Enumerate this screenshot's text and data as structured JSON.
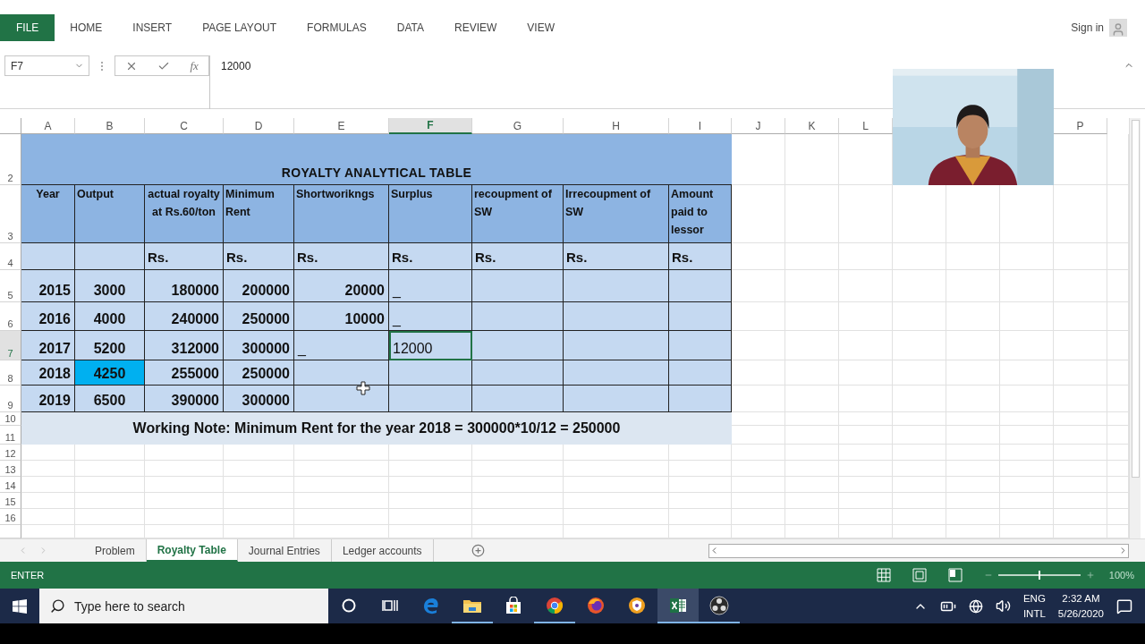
{
  "ribbon": {
    "tabs": [
      {
        "label": "FILE",
        "kind": "file"
      },
      {
        "label": "HOME",
        "kind": "tab"
      },
      {
        "label": "INSERT",
        "kind": "tab"
      },
      {
        "label": "PAGE LAYOUT",
        "kind": "tab"
      },
      {
        "label": "FORMULAS",
        "kind": "tab"
      },
      {
        "label": "DATA",
        "kind": "tab"
      },
      {
        "label": "REVIEW",
        "kind": "tab"
      },
      {
        "label": "VIEW",
        "kind": "tab"
      }
    ],
    "sign_in": "Sign in"
  },
  "formula_bar": {
    "name_box": "F7",
    "fx": "fx",
    "value": "12000"
  },
  "sheet": {
    "columns": [
      {
        "label": "A",
        "selected": false
      },
      {
        "label": "B",
        "selected": false
      },
      {
        "label": "C",
        "selected": false
      },
      {
        "label": "D",
        "selected": false
      },
      {
        "label": "E",
        "selected": false
      },
      {
        "label": "F",
        "selected": true
      },
      {
        "label": "G",
        "selected": false
      },
      {
        "label": "H",
        "selected": false
      },
      {
        "label": "I",
        "selected": false
      },
      {
        "label": "J",
        "selected": false
      },
      {
        "label": "K",
        "selected": false
      },
      {
        "label": "L",
        "selected": false
      },
      {
        "label": "P",
        "selected": false
      }
    ],
    "row_numbers": [
      {
        "label": "2",
        "selected": false
      },
      {
        "label": "3",
        "selected": false
      },
      {
        "label": "4",
        "selected": false
      },
      {
        "label": "5",
        "selected": false
      },
      {
        "label": "6",
        "selected": false
      },
      {
        "label": "7",
        "selected": true
      },
      {
        "label": "8",
        "selected": false
      },
      {
        "label": "9",
        "selected": false
      },
      {
        "label": "10",
        "selected": false
      },
      {
        "label": "11",
        "selected": false
      },
      {
        "label": "12",
        "selected": false
      },
      {
        "label": "13",
        "selected": false
      },
      {
        "label": "14",
        "selected": false
      },
      {
        "label": "15",
        "selected": false
      },
      {
        "label": "16",
        "selected": false
      }
    ],
    "title": "ROYALTY ANALYTICAL TABLE",
    "headers": [
      "Year",
      "Output",
      "actual royalty at Rs.60/ton",
      "Minimum Rent",
      "Shortworikngs",
      "Surplus",
      "recoupment of SW",
      "Irrecoupment of SW",
      "Amount paid to lessor"
    ],
    "units": [
      "Rs.",
      "Rs.",
      "Rs.",
      "Rs.",
      "Rs.",
      "Rs.",
      "Rs."
    ],
    "rows": [
      {
        "cells": [
          {
            "text": "2015",
            "kind": "number",
            "selected": false,
            "highlighted": false
          },
          {
            "text": "3000",
            "kind": "number",
            "selected": false,
            "highlighted": false
          },
          {
            "text": "180000",
            "kind": "number",
            "selected": false,
            "highlighted": false
          },
          {
            "text": "200000",
            "kind": "number",
            "selected": false,
            "highlighted": false
          },
          {
            "text": "20000",
            "kind": "number",
            "selected": false,
            "highlighted": false
          },
          {
            "text": "_",
            "kind": "text",
            "selected": false,
            "highlighted": false
          },
          {
            "selected": false,
            "highlighted": false
          },
          {
            "selected": false,
            "highlighted": false
          },
          {
            "selected": false,
            "highlighted": false
          }
        ]
      },
      {
        "cells": [
          {
            "text": "2016",
            "kind": "number",
            "selected": false,
            "highlighted": false
          },
          {
            "text": "4000",
            "kind": "number",
            "selected": false,
            "highlighted": false
          },
          {
            "text": "240000",
            "kind": "number",
            "selected": false,
            "highlighted": false
          },
          {
            "text": "250000",
            "kind": "number",
            "selected": false,
            "highlighted": false
          },
          {
            "text": "10000",
            "kind": "number",
            "selected": false,
            "highlighted": false
          },
          {
            "text": "_",
            "kind": "text",
            "selected": false,
            "highlighted": false
          },
          {
            "selected": false,
            "highlighted": false
          },
          {
            "selected": false,
            "highlighted": false
          },
          {
            "selected": false,
            "highlighted": false
          }
        ]
      },
      {
        "cells": [
          {
            "text": "2017",
            "kind": "number",
            "selected": false,
            "highlighted": false
          },
          {
            "text": "5200",
            "kind": "number",
            "selected": false,
            "highlighted": false
          },
          {
            "text": "312000",
            "kind": "number",
            "selected": false,
            "highlighted": false
          },
          {
            "text": "300000",
            "kind": "number",
            "selected": false,
            "highlighted": false
          },
          {
            "text": "_",
            "kind": "text",
            "selected": false,
            "highlighted": false
          },
          {
            "text": "12000",
            "kind": "entry",
            "selected": true,
            "highlighted": false
          },
          {
            "selected": false,
            "highlighted": false
          },
          {
            "selected": false,
            "highlighted": false
          },
          {
            "selected": false,
            "highlighted": false
          }
        ]
      },
      {
        "cells": [
          {
            "text": "2018",
            "kind": "number",
            "selected": false,
            "highlighted": false
          },
          {
            "text": "4250",
            "kind": "number",
            "selected": false,
            "highlighted": true
          },
          {
            "text": "255000",
            "kind": "number",
            "selected": false,
            "highlighted": false
          },
          {
            "text": "250000",
            "kind": "number",
            "selected": false,
            "highlighted": false
          },
          {
            "selected": false,
            "highlighted": false
          },
          {
            "selected": false,
            "highlighted": false
          },
          {
            "selected": false,
            "highlighted": false
          },
          {
            "selected": false,
            "highlighted": false
          },
          {
            "selected": false,
            "highlighted": false
          }
        ]
      },
      {
        "cells": [
          {
            "text": "2019",
            "kind": "number",
            "selected": false,
            "highlighted": false
          },
          {
            "text": "6500",
            "kind": "number",
            "selected": false,
            "highlighted": false
          },
          {
            "text": "390000",
            "kind": "number",
            "selected": false,
            "highlighted": false
          },
          {
            "text": "300000",
            "kind": "number",
            "selected": false,
            "highlighted": false
          },
          {
            "selected": false,
            "highlighted": false
          },
          {
            "selected": false,
            "highlighted": false
          },
          {
            "selected": false,
            "highlighted": false
          },
          {
            "selected": false,
            "highlighted": false
          },
          {
            "selected": false,
            "highlighted": false
          }
        ]
      }
    ],
    "note": "Working Note: Minimum Rent for the year 2018 = 300000*10/12 = 250000"
  },
  "sheet_tabs": [
    {
      "label": "Problem",
      "selected": false
    },
    {
      "label": "Royalty Table",
      "selected": true
    },
    {
      "label": "Journal Entries",
      "selected": false
    },
    {
      "label": "Ledger accounts",
      "selected": false
    }
  ],
  "status_bar": {
    "mode": "ENTER",
    "level": 0.5,
    "zoom": "100%"
  },
  "taskbar": {
    "search_placeholder": "Type here to search",
    "apps": [
      {
        "kind": "cortana",
        "running": false
      },
      {
        "kind": "taskview",
        "running": false
      },
      {
        "kind": "edge",
        "running": false
      },
      {
        "kind": "folder",
        "running": true
      },
      {
        "kind": "store",
        "running": false
      },
      {
        "kind": "chrome",
        "running": true
      },
      {
        "kind": "firefox",
        "running": false
      },
      {
        "kind": "shield",
        "running": false
      },
      {
        "kind": "excel",
        "running": true
      },
      {
        "kind": "obs",
        "running": true
      }
    ],
    "language": "ENG",
    "layout": "INTL",
    "time": "2:32 AM",
    "date": "5/26/2020"
  }
}
